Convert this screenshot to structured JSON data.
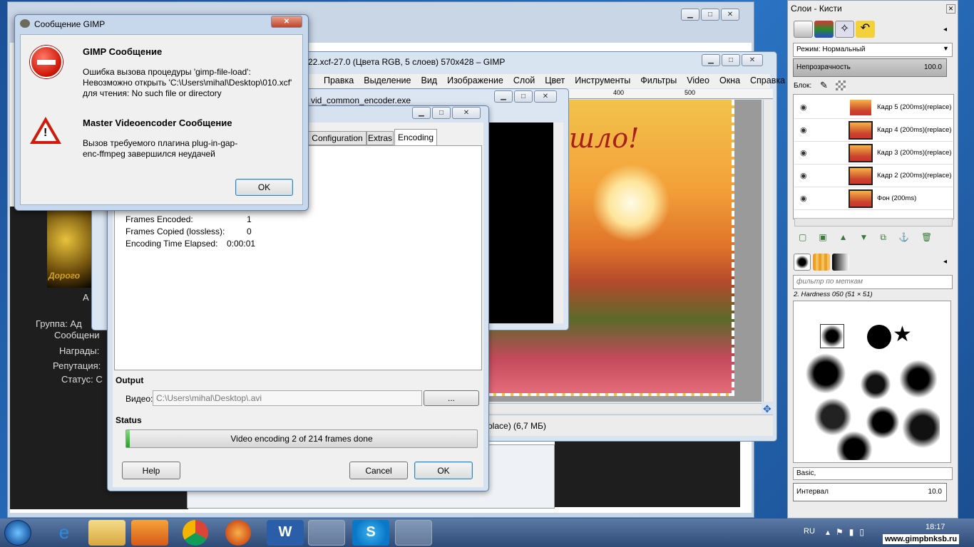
{
  "gimp_message": {
    "title": "Сообщение GIMP",
    "msg1_heading": "GIMP Сообщение",
    "msg1_line1": "Ошибка вызова процедуры 'gimp-file-load':",
    "msg1_line2": "Невозможно открыть 'C:\\Users\\mihal\\Desktop\\010.xcf'",
    "msg1_line3": "для чтения: No such file or directory",
    "msg2_heading": "Master Videoencoder Сообщение",
    "msg2_line1": "Вызов требуемого плагина plug-in-gap-",
    "msg2_line2": "enc-ffmpeg завершился неудачей",
    "ok_label": "OK"
  },
  "gimp_main": {
    "title": "22.xcf-27.0 (Цвета RGB, 5 слоев) 570x428 – GIMP",
    "menu": [
      "Правка",
      "Выделение",
      "Вид",
      "Изображение",
      "Слой",
      "Цвет",
      "Инструменты",
      "Фильтры",
      "Video",
      "Окна",
      "Справка"
    ],
    "ruler": [
      "400",
      "500"
    ],
    "canvas_text": "шло!",
    "status": "place) (6,7 МБ)"
  },
  "encoder_back": {
    "title": "vid_common_encoder.exe"
  },
  "encoder": {
    "tabs": [
      "Configuration",
      "Extras",
      "Encoding"
    ],
    "stats": [
      {
        "label": "Frames Encoded:",
        "value": "1"
      },
      {
        "label": "Frames Copied (lossless):",
        "value": "0"
      },
      {
        "label": "Encoding Time Elapsed:",
        "value": "0:00:01"
      }
    ],
    "output_heading": "Output",
    "video_label": "Видео:",
    "video_path": "C:\\Users\\mihal\\Desktop\\.avi",
    "browse_label": "...",
    "status_heading": "Status",
    "progress_text": "Video encoding 2 of 214 frames done",
    "progress": 0.01,
    "help": "Help",
    "cancel": "Cancel",
    "ok": "OK"
  },
  "left_profile": {
    "group": "Группа: Ад",
    "messages": "Сообщени",
    "awards": "Награды:",
    "reputation": "Репутация:",
    "status": "Статус: С",
    "letter": "А",
    "logo_text": "Дорого"
  },
  "layers_panel": {
    "title": "Слои - Кисти",
    "mode_label": "Режим: Нормальный",
    "opacity_label": "Непрозрачность",
    "opacity_value": "100.0",
    "lock_label": "Блок:",
    "layers": [
      "Кадр 5  (200ms)(replace)",
      "Кадр 4  (200ms)(replace)",
      "Кадр 3  (200ms)(replace)",
      "Кадр 2  (200ms)(replace)",
      "Фон (200ms)"
    ],
    "filter_placeholder": "фильтр по меткам",
    "brush_name": "2. Hardness 050 (51 × 51)",
    "preset": "Basic,",
    "interval_label": "Интервал",
    "interval_value": "10.0"
  },
  "taskbar": {
    "lang": "RU",
    "time": "18:17",
    "watermark": "www.gimpbnksb.ru"
  }
}
